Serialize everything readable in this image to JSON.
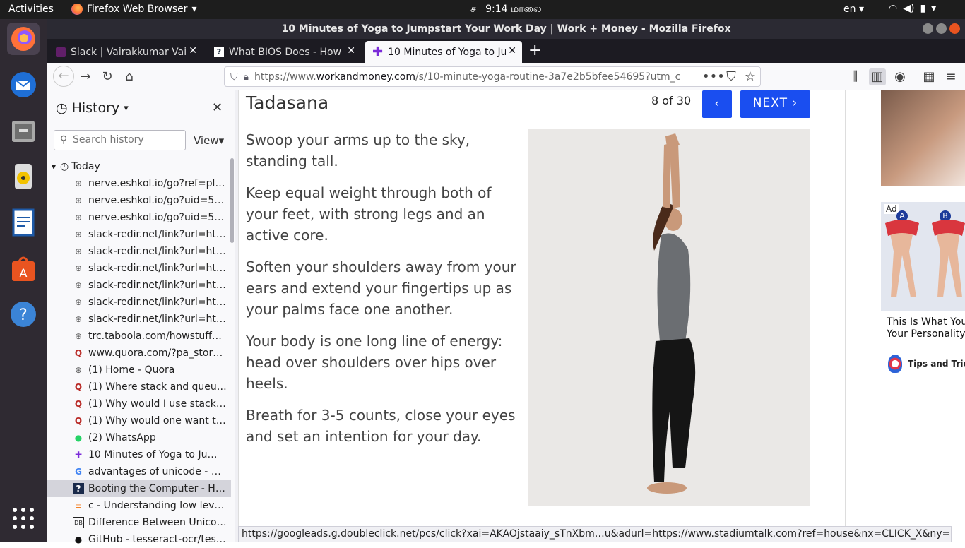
{
  "topbar": {
    "activities": "Activities",
    "app_menu": "Firefox Web Browser",
    "clock": "9:14 மாலை",
    "clock_prefix": "ச",
    "lang": "en"
  },
  "window": {
    "title": "10 Minutes of Yoga to Jumpstart Your Work Day | Work + Money - Mozilla Firefox"
  },
  "tabs": [
    {
      "label": "Slack | Vairakkumar Vaira"
    },
    {
      "label": "What BIOS Does - How B"
    },
    {
      "label": "10 Minutes of Yoga to Ju"
    }
  ],
  "urlbar": {
    "prefix": "https://www.",
    "domain": "workandmoney.com",
    "path": "/s/10-minute-yoga-routine-3a7e2b5bfee54695?utm_c"
  },
  "sidebar": {
    "title": "History",
    "search_placeholder": "Search history",
    "view_label": "View",
    "group": "Today",
    "items": [
      {
        "icon": "globe-icon",
        "title": "nerve.eshkol.io/go?ref=pl&h..."
      },
      {
        "icon": "globe-icon",
        "title": "nerve.eshkol.io/go?uid=5e1..."
      },
      {
        "icon": "globe-icon",
        "title": "nerve.eshkol.io/go?uid=5e1..."
      },
      {
        "icon": "globe-icon",
        "title": "slack-redir.net/link?url=http..."
      },
      {
        "icon": "globe-icon",
        "title": "slack-redir.net/link?url=http..."
      },
      {
        "icon": "globe-icon",
        "title": "slack-redir.net/link?url=http..."
      },
      {
        "icon": "globe-icon",
        "title": "slack-redir.net/link?url=http..."
      },
      {
        "icon": "globe-icon",
        "title": "slack-redir.net/link?url=http..."
      },
      {
        "icon": "globe-icon",
        "title": "slack-redir.net/link?url=http..."
      },
      {
        "icon": "globe-icon",
        "title": "trc.taboola.com/howstuffwo..."
      },
      {
        "icon": "quora-icon",
        "title": "www.quora.com/?pa_story=..."
      },
      {
        "icon": "globe-icon",
        "title": "(1) Home - Quora"
      },
      {
        "icon": "quora-icon",
        "title": "(1) Where stack and queue u..."
      },
      {
        "icon": "quora-icon",
        "title": "(1) Why would I use stack ins..."
      },
      {
        "icon": "quora-icon",
        "title": "(1) Why would one want to u..."
      },
      {
        "icon": "whatsapp-icon",
        "title": "(2) WhatsApp"
      },
      {
        "icon": "plus-icon",
        "title": "10 Minutes of Yoga to Jump..."
      },
      {
        "icon": "google-icon",
        "title": "advantages of unicode - Goo..."
      },
      {
        "icon": "howstuff-icon",
        "title": "Booting the Computer - How..."
      },
      {
        "icon": "stackoverflow-icon",
        "title": "c - Understanding low level f..."
      },
      {
        "icon": "db-icon",
        "title": "Difference Between Unicod..."
      },
      {
        "icon": "github-icon",
        "title": "GitHub - tesseract-ocr/tessd..."
      }
    ],
    "selected_index": 18
  },
  "article": {
    "title": "Tadasana",
    "counter": "8 of 30",
    "prev_label": "‹",
    "next_label": "NEXT ›",
    "paragraphs": [
      "Swoop your arms up to the sky, standing tall.",
      "Keep equal weight through both of your feet, with strong legs and an active core.",
      "Soften your shoulders away from your ears and extend your fingertips up as your palms face one another.",
      "Your body is one long line of energy: head over shoulders over hips over heels.",
      "Breath for 3-5 counts, close your eyes and set an intention for your day."
    ]
  },
  "ad": {
    "label": "Ad",
    "option_a": "A",
    "option_b": "B",
    "headline_1": "This Is What You",
    "headline_2": "Your Personality",
    "brand": "Tips and Tric"
  },
  "status_url": "https://googleads.g.doubleclick.net/pcs/click?xai=AKAOjstaaiy_sTnXbm…u&adurl=https://www.stadiumtalk.com?ref=house&nx=CLICK_X&ny=CLICK_Y",
  "colors": {
    "accent": "#1a4ef0",
    "dock": "#2f2a32",
    "tabbar": "#1c1b22"
  }
}
